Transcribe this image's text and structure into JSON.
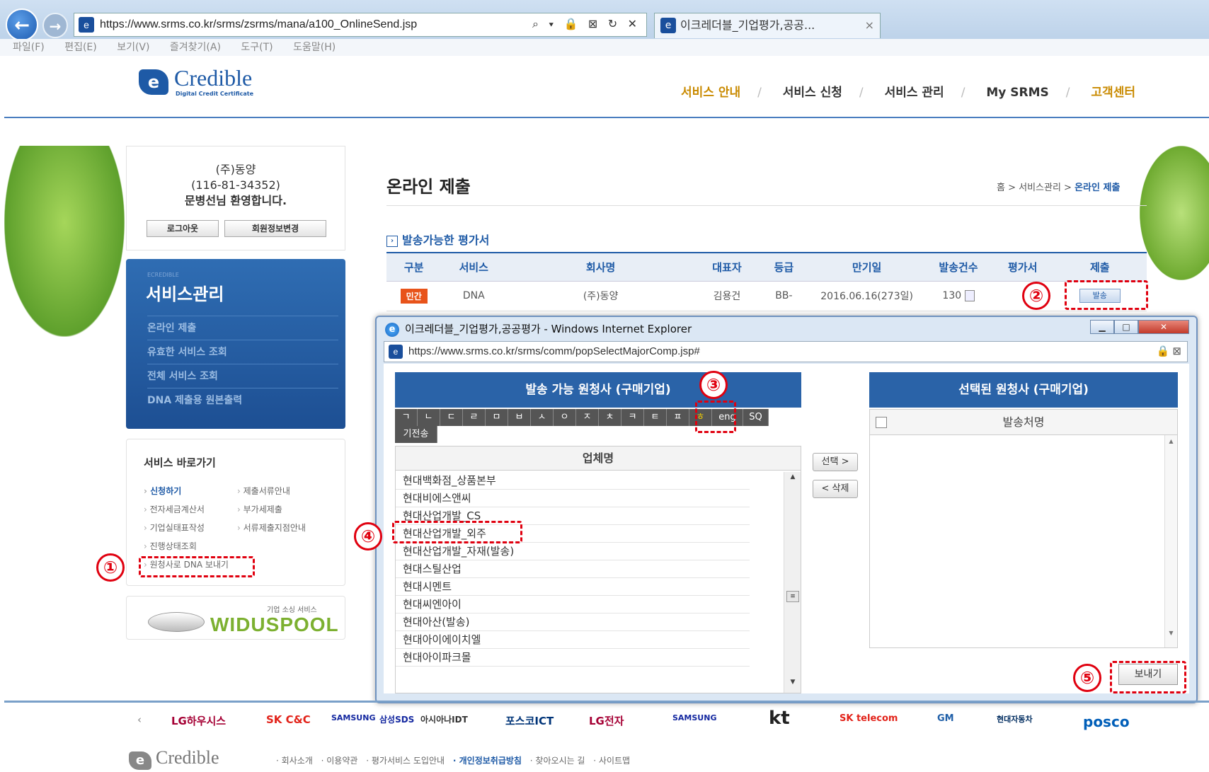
{
  "browser": {
    "url": "https://www.srms.co.kr/srms/zsrms/mana/a100_OnlineSend.jsp",
    "addr_tools": "⌕ ▾ 🔒 ⊠ ↻ ✕",
    "tab_title": "이크레더블_기업평가,공공...",
    "tab_close": "×",
    "menu": [
      "파일(F)",
      "편집(E)",
      "보기(V)",
      "즐겨찾기(A)",
      "도구(T)",
      "도움말(H)"
    ]
  },
  "site": {
    "logo": "Credible",
    "logo_sub": "Digital Credit Certificate",
    "nav": [
      "서비스 안내",
      "서비스 신청",
      "서비스 관리",
      "My SRMS",
      "고객센터"
    ]
  },
  "user": {
    "company": "(주)동양",
    "biz_no": "(116-81-34352)",
    "welcome": "문병선님 환영합니다.",
    "logout": "로그아웃",
    "edit_info": "회원정보변경"
  },
  "service_menu": {
    "eyebrow": "ECREDIBLE",
    "title": "서비스관리",
    "items": [
      "온라인 제출",
      "유효한 서비스 조회",
      "전체 서비스 조회",
      "DNA 제출용 원본출력"
    ]
  },
  "quick": {
    "title": "서비스 바로가기",
    "left": [
      "신청하기",
      "전자세금계산서",
      "기업실태표작성",
      "진행상태조회",
      "원청사로 DNA 보내기"
    ],
    "right": [
      "제출서류안내",
      "부가세제출",
      "서류제출지점안내"
    ]
  },
  "widus": {
    "small": "기업 소싱 서비스",
    "big": "WIDUSPOOL"
  },
  "main": {
    "title": "온라인 제출",
    "breadcrumb_pre": "홈 > 서비스관리 > ",
    "breadcrumb_cur": "온라인 제출",
    "subhead": "발송가능한 평가서",
    "columns": [
      "구분",
      "서비스",
      "회사명",
      "대표자",
      "등급",
      "만기일",
      "발송건수",
      "평가서",
      "제출"
    ],
    "row": {
      "type": "민간",
      "service": "DNA",
      "company": "(주)동양",
      "ceo": "김용건",
      "grade": "BB-",
      "expiry": "2016.06.16(273일)",
      "count": "130",
      "submit": "발송"
    }
  },
  "popup": {
    "title": "이크레더블_기업평가,공공평가 - Windows Internet Explorer",
    "url": "https://www.srms.co.kr/srms/comm/popSelectMajorComp.jsp#",
    "left_header": "발송 가능 원청사 (구매기업)",
    "right_header": "선택된 원청사 (구매기업)",
    "alphabet": [
      "ㄱ",
      "ㄴ",
      "ㄷ",
      "ㄹ",
      "ㅁ",
      "ㅂ",
      "ㅅ",
      "ㅇ",
      "ㅈ",
      "ㅊ",
      "ㅋ",
      "ㅌ",
      "ㅍ",
      "ㅎ",
      "eng",
      "SQ",
      "기전송"
    ],
    "left_col": "업체명",
    "companies": [
      "현대백화점_상품본부",
      "현대비에스앤씨",
      "현대산업개발_CS",
      "현대산업개발_외주",
      "현대산업개발_자재(발송)",
      "현대스틸산업",
      "현대시멘트",
      "현대씨엔아이",
      "현대아산(발송)",
      "현대아이에이치엘",
      "현대아이파크몰"
    ],
    "select_btn": "선택 >",
    "delete_btn": "< 삭제",
    "right_col": "발송처명",
    "send_btn": "보내기"
  },
  "annotations": [
    "①",
    "②",
    "③",
    "④",
    "⑤"
  ],
  "footer": {
    "partners": [
      "LG하우시스",
      "SK C&C",
      "SAMSUNG",
      "삼성SDS",
      "아시아나IDT",
      "포스코ICT",
      "LG전자",
      "SAMSUNG",
      "kt",
      "SK telecom",
      "GM",
      "현대자동차",
      "posco"
    ],
    "logo": "Credible",
    "links": [
      "· 회사소개",
      "· 이용약관",
      "· 평가서비스 도입안내",
      "· 개인정보취급방침",
      "· 찾아오시는 길",
      "· 사이트맵"
    ]
  },
  "colors": {
    "accent": "#1e5aa6",
    "nav_highlight": "#c98a00",
    "badge": "#e8531a",
    "annotation": "#e0000f"
  }
}
